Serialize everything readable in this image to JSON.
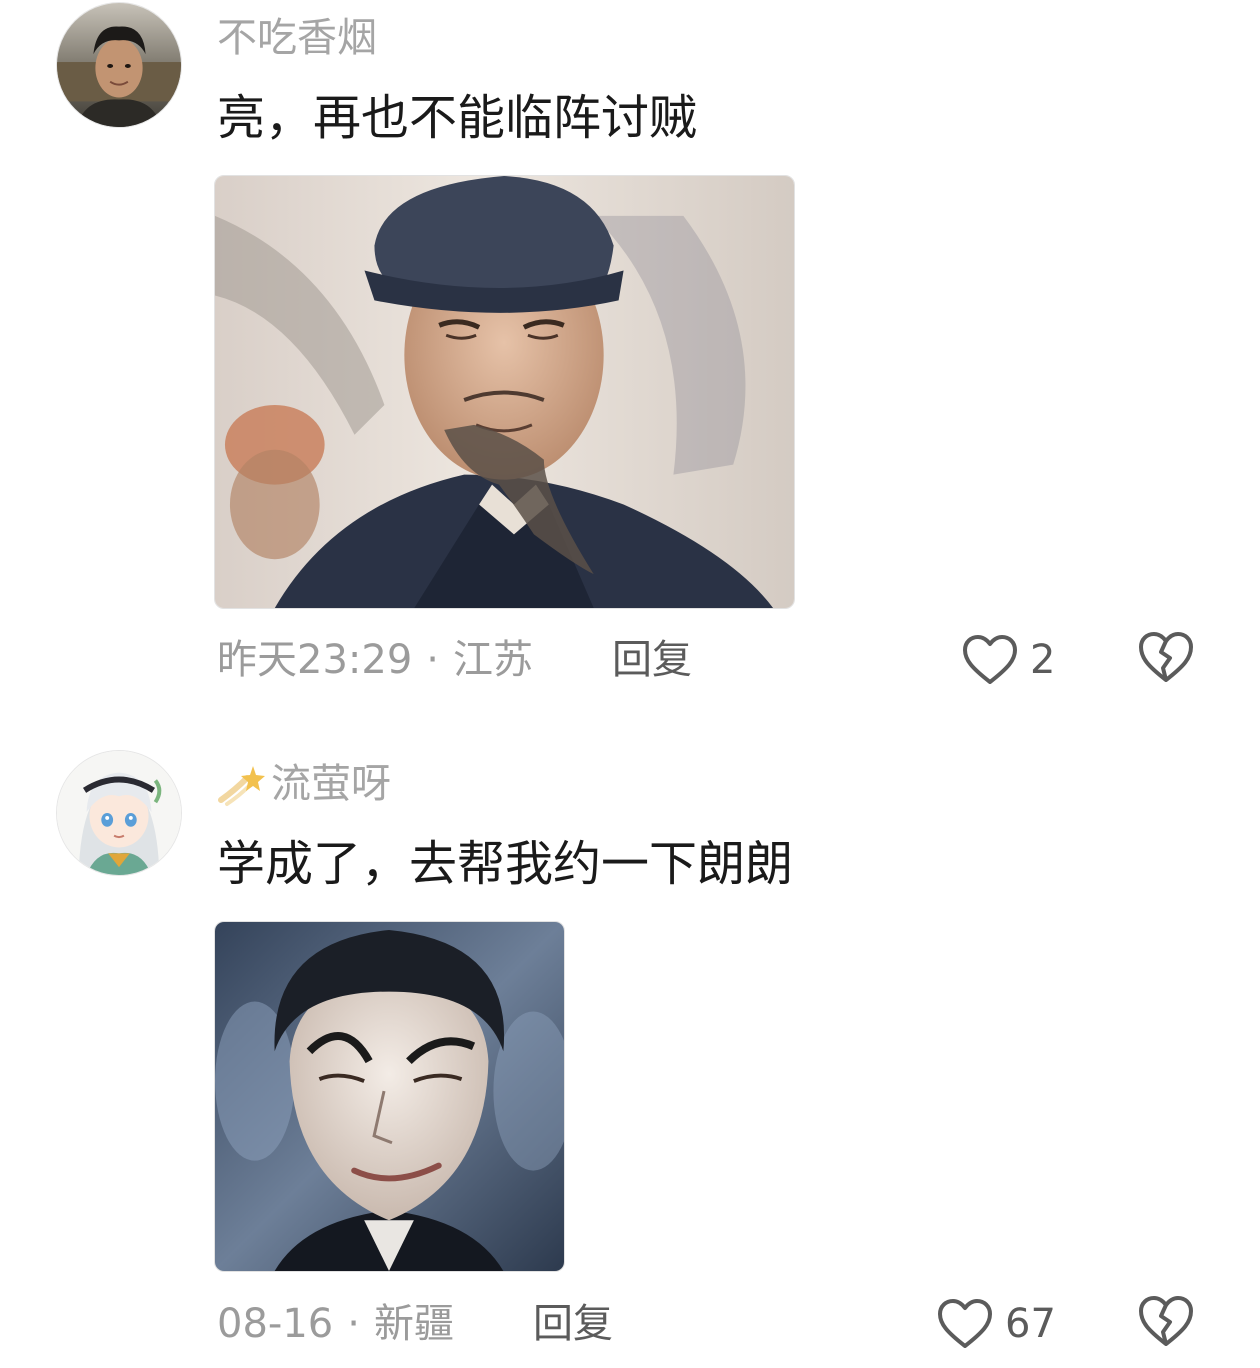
{
  "comments": [
    {
      "username": "不吃香烟",
      "text": "亮，再也不能临阵讨贼",
      "time": "昨天23:29",
      "location": "江苏",
      "reply_label": "回复",
      "likes": "2",
      "avatar_icon": "user-avatar-photo",
      "media_icon": "meme-image-zhuge-liang"
    },
    {
      "username": "流萤呀",
      "badge_icon": "shooting-star-icon",
      "text": "学成了，去帮我约一下朗朗",
      "time": "08-16",
      "location": "新疆",
      "reply_label": "回复",
      "likes": "67",
      "avatar_icon": "anime-avatar",
      "media_icon": "meme-image-smirk-character"
    }
  ],
  "separator": "·",
  "colors": {
    "username": "#a5a5a5",
    "text": "#1a1a1a",
    "meta": "#9b9b9b",
    "action": "#5b5b5b"
  }
}
